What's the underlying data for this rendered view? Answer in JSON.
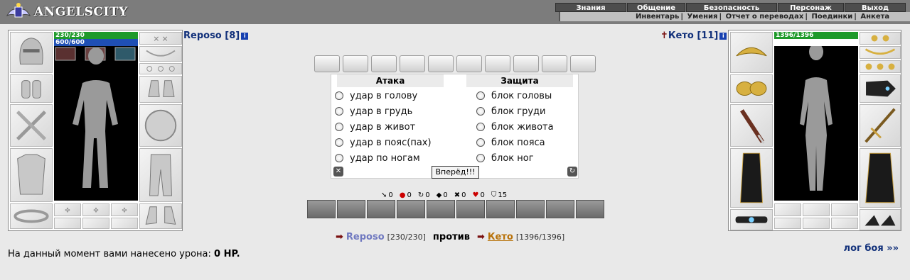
{
  "header": {
    "logo_text": "ANGELSCITY",
    "menu_top": [
      "Знания",
      "Общение",
      "Безопасность",
      "Персонаж",
      "Выход"
    ],
    "menu_sub": [
      "Инвентарь",
      "Умения",
      "Отчет о переводах",
      "Поединки",
      "Анкета"
    ]
  },
  "player": {
    "name": "Reposo [8]",
    "hp": "230/230",
    "mana": "600/600"
  },
  "enemy": {
    "name": "Кето [11]",
    "hp": "1396/1396"
  },
  "fight": {
    "attack_title": "Атака",
    "defense_title": "Защита",
    "attacks": [
      "удар в голову",
      "удар в грудь",
      "удар в живот",
      "удар в пояс(пах)",
      "удар по ногам"
    ],
    "defenses": [
      "блок головы",
      "блок груди",
      "блок живота",
      "блок пояса",
      "блок ног"
    ],
    "submit_label": "Вперёд!!!"
  },
  "stats": [
    "0",
    "0",
    "0",
    "0",
    "0",
    "0",
    "15"
  ],
  "versus": {
    "p1_name": "Reposo",
    "p1_hp": "[230/230]",
    "against": "против",
    "p2_name": "Кето",
    "p2_hp": "[1396/1396]"
  },
  "damage": {
    "label": "На данный момент вами нанесено урона:",
    "value": "0 HP."
  },
  "log_link": "лог боя »»",
  "colors": {
    "hp": "#1e9a2a",
    "mana": "#1f4fb4",
    "accent": "#11307a"
  }
}
